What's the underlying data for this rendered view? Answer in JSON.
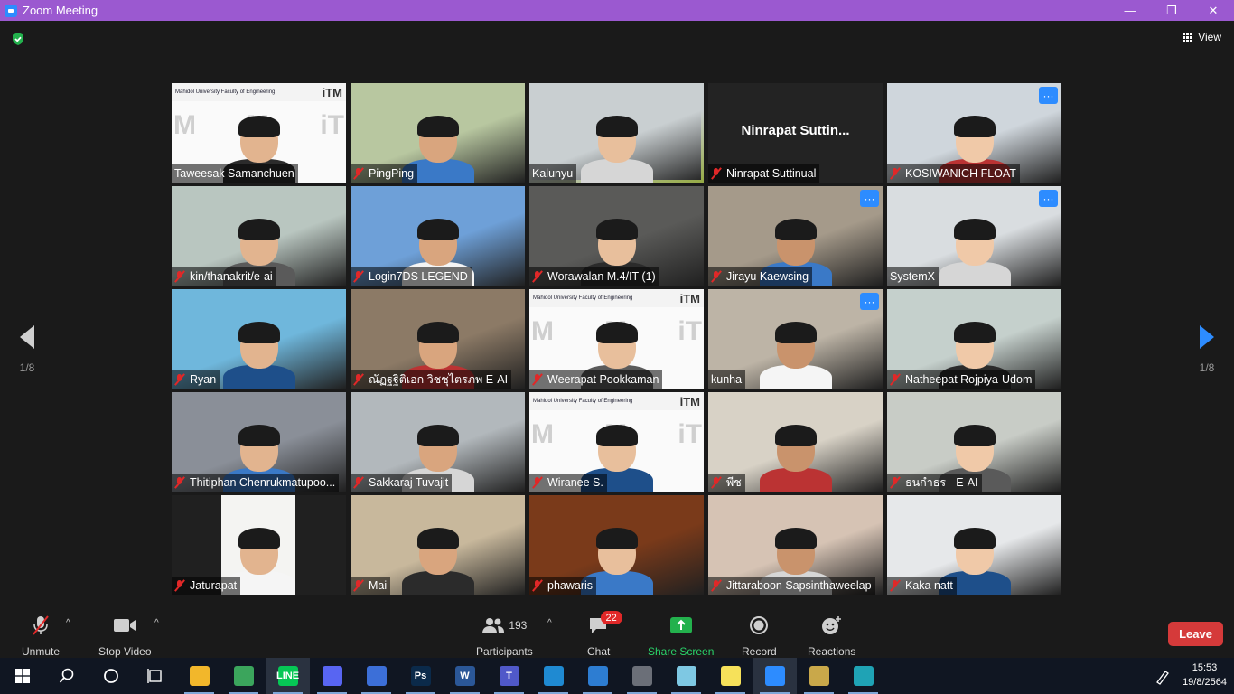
{
  "window": {
    "title": "Zoom Meeting",
    "minimize": "—",
    "restore": "❐",
    "close": "✕"
  },
  "top": {
    "view_label": "View",
    "security_icon": "shield-check-icon"
  },
  "pagination": {
    "left_page": "1/8",
    "right_page": "1/8"
  },
  "participants_tiles": [
    {
      "name": "Taweesak Samanchuen",
      "muted": false,
      "more": false,
      "bg": "itm"
    },
    {
      "name": "PingPing",
      "muted": true,
      "more": false,
      "bg": "#b8c7a0"
    },
    {
      "name": "Kalunyu",
      "muted": false,
      "more": false,
      "bg": "#c9cfd1",
      "active": true
    },
    {
      "name": "Ninrapat Suttinual",
      "muted": true,
      "more": false,
      "bg": "off",
      "display_name": "Ninrapat  Suttin..."
    },
    {
      "name": "KOSIWANICH FLOAT",
      "muted": true,
      "more": true,
      "bg": "#cfd6dc"
    },
    {
      "name": "kin/thanakrit/e-ai",
      "muted": true,
      "more": false,
      "bg": "#b9c6c0"
    },
    {
      "name": "Login7DS  LEGEND",
      "muted": true,
      "more": false,
      "bg": "#6ea0d8"
    },
    {
      "name": "Worawalan M.4/IT (1)",
      "muted": true,
      "more": false,
      "bg": "#5a5a58"
    },
    {
      "name": "Jirayu Kaewsing",
      "muted": true,
      "more": true,
      "bg": "#a59a8a"
    },
    {
      "name": "SystemX",
      "muted": false,
      "more": true,
      "bg": "#d9dde0"
    },
    {
      "name": "Ryan",
      "muted": true,
      "more": false,
      "bg": "#6fb7dc"
    },
    {
      "name": "ณัฏฐฐิติเอก วิชชุไตรภพ E-AI",
      "muted": true,
      "more": false,
      "bg": "#8c7a66"
    },
    {
      "name": "Weerapat Pookkaman",
      "muted": true,
      "more": false,
      "bg": "itm"
    },
    {
      "name": "kunha",
      "muted": false,
      "more": true,
      "bg": "#bdb4a6"
    },
    {
      "name": "Natheepat Rojpiya-Udom",
      "muted": true,
      "more": false,
      "bg": "#c5d0cc"
    },
    {
      "name": "Thitiphan Chenrukmatupoo...",
      "muted": true,
      "more": false,
      "bg": "#8a8f98"
    },
    {
      "name": "Sakkaraj Tuvajit",
      "muted": true,
      "more": false,
      "bg": "#b2b8bc"
    },
    {
      "name": "Wiranee S.",
      "muted": true,
      "more": false,
      "bg": "itm"
    },
    {
      "name": "พีช",
      "muted": true,
      "more": false,
      "bg": "#d8d2c6"
    },
    {
      "name": "ธนกำธร - E-AI",
      "muted": true,
      "more": false,
      "bg": "#c8ccc6"
    },
    {
      "name": "Jaturapat",
      "muted": true,
      "more": false,
      "bg": "jatu"
    },
    {
      "name": "Mai",
      "muted": true,
      "more": false,
      "bg": "#c8b89c"
    },
    {
      "name": "phawaris",
      "muted": true,
      "more": false,
      "bg": "#7a3a1a"
    },
    {
      "name": "Jittaraboon Sapsinthaweelap",
      "muted": true,
      "more": false,
      "bg": "#d6c3b4"
    },
    {
      "name": "Kaka natt",
      "muted": true,
      "more": false,
      "bg": "#e6e8ea"
    }
  ],
  "itm_logo": {
    "left_text": "Mahidol University Faculty of Engineering",
    "right_text": "iTM"
  },
  "toolbar": {
    "unmute_label": "Unmute",
    "stop_video_label": "Stop Video",
    "participants_label": "Participants",
    "participants_count": "193",
    "chat_label": "Chat",
    "chat_badge": "22",
    "share_label": "Share Screen",
    "record_label": "Record",
    "reactions_label": "Reactions",
    "leave_label": "Leave",
    "caret": "^"
  },
  "taskbar": {
    "time": "15:53",
    "date": "19/8/2564",
    "apps": [
      {
        "name": "file-explorer-icon",
        "color": "#f2b72b",
        "label": ""
      },
      {
        "name": "chrome-icon",
        "color": "#3ba55c",
        "label": ""
      },
      {
        "name": "line-icon",
        "color": "#06c755",
        "label": "LINE",
        "active": true
      },
      {
        "name": "discord-icon",
        "color": "#5865f2",
        "label": ""
      },
      {
        "name": "todo-icon",
        "color": "#3c6fd8",
        "label": ""
      },
      {
        "name": "photoshop-icon",
        "color": "#0b2a4a",
        "label": "Ps"
      },
      {
        "name": "word-icon",
        "color": "#2b5797",
        "label": "W"
      },
      {
        "name": "teams-icon",
        "color": "#5059c9",
        "label": "T"
      },
      {
        "name": "vscode-icon",
        "color": "#1f8ad2",
        "label": ""
      },
      {
        "name": "photos-icon",
        "color": "#2d7dd2",
        "label": ""
      },
      {
        "name": "calculator-icon",
        "color": "#6b6f78",
        "label": ""
      },
      {
        "name": "app-icon",
        "color": "#7ec8e3",
        "label": ""
      },
      {
        "name": "sticky-notes-icon",
        "color": "#f6e15a",
        "label": ""
      },
      {
        "name": "zoom-icon",
        "color": "#2d8cff",
        "label": "",
        "active": true
      },
      {
        "name": "archive-icon",
        "color": "#c9a84a",
        "label": ""
      },
      {
        "name": "edge-icon",
        "color": "#1fa3b5",
        "label": ""
      }
    ]
  }
}
